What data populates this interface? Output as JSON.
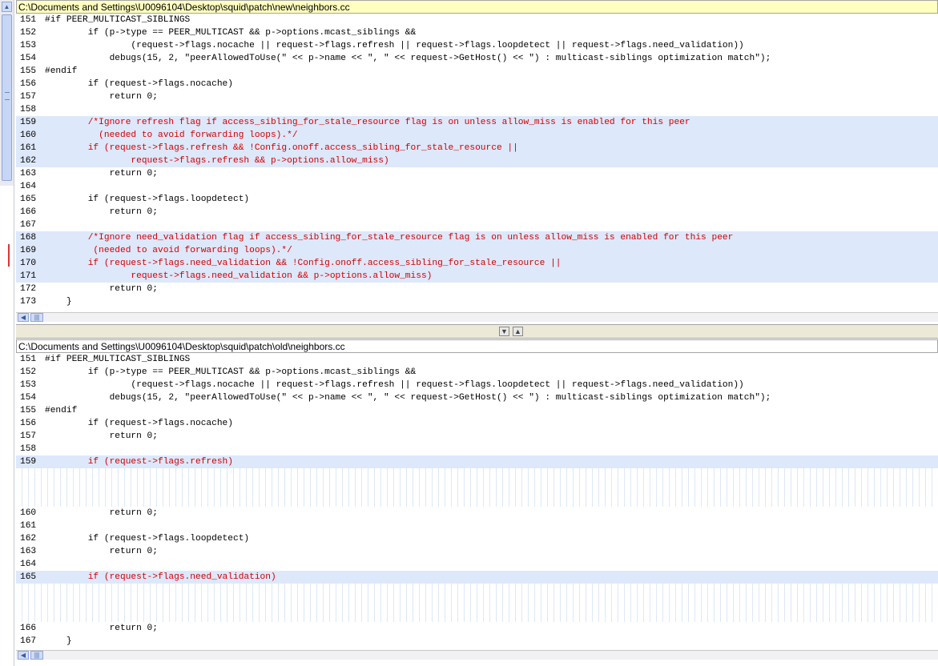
{
  "top_pane": {
    "title": "C:\\Documents and Settings\\U0096104\\Desktop\\squid\\patch\\new\\neighbors.cc",
    "lines": [
      {
        "n": "151",
        "code": "#if PEER_MULTICAST_SIBLINGS",
        "changed": false
      },
      {
        "n": "152",
        "code": "        if (p->type == PEER_MULTICAST && p->options.mcast_siblings &&",
        "changed": false
      },
      {
        "n": "153",
        "code": "                (request->flags.nocache || request->flags.refresh || request->flags.loopdetect || request->flags.need_validation))",
        "changed": false
      },
      {
        "n": "154",
        "code": "            debugs(15, 2, \"peerAllowedToUse(\" << p->name << \", \" << request->GetHost() << \") : multicast-siblings optimization match\");",
        "changed": false
      },
      {
        "n": "155",
        "code": "#endif",
        "changed": false
      },
      {
        "n": "156",
        "code": "        if (request->flags.nocache)",
        "changed": false
      },
      {
        "n": "157",
        "code": "            return 0;",
        "changed": false
      },
      {
        "n": "158",
        "code": "",
        "changed": false
      },
      {
        "n": "159",
        "code": "        /*Ignore refresh flag if access_sibling_for_stale_resource flag is on unless allow_miss is enabled for this peer",
        "changed": true
      },
      {
        "n": "160",
        "code": "          (needed to avoid forwarding loops).*/",
        "changed": true
      },
      {
        "n": "161",
        "code": "        if (request->flags.refresh && !Config.onoff.access_sibling_for_stale_resource ||",
        "changed": true
      },
      {
        "n": "162",
        "code": "                request->flags.refresh && p->options.allow_miss)",
        "changed": true
      },
      {
        "n": "163",
        "code": "            return 0;",
        "changed": false
      },
      {
        "n": "164",
        "code": "",
        "changed": false
      },
      {
        "n": "165",
        "code": "        if (request->flags.loopdetect)",
        "changed": false
      },
      {
        "n": "166",
        "code": "            return 0;",
        "changed": false
      },
      {
        "n": "167",
        "code": "",
        "changed": false
      },
      {
        "n": "168",
        "code": "        /*Ignore need_validation flag if access_sibling_for_stale_resource flag is on unless allow_miss is enabled for this peer",
        "changed": true
      },
      {
        "n": "169",
        "code": "         (needed to avoid forwarding loops).*/",
        "changed": true
      },
      {
        "n": "170",
        "code": "        if (request->flags.need_validation && !Config.onoff.access_sibling_for_stale_resource ||",
        "changed": true
      },
      {
        "n": "171",
        "code": "                request->flags.need_validation && p->options.allow_miss)",
        "changed": true
      },
      {
        "n": "172",
        "code": "            return 0;",
        "changed": false
      },
      {
        "n": "173",
        "code": "    }",
        "changed": false
      }
    ]
  },
  "bottom_pane": {
    "title": "C:\\Documents and Settings\\U0096104\\Desktop\\squid\\patch\\old\\neighbors.cc",
    "lines": [
      {
        "n": "151",
        "code": "#if PEER_MULTICAST_SIBLINGS",
        "kind": "normal"
      },
      {
        "n": "152",
        "code": "        if (p->type == PEER_MULTICAST && p->options.mcast_siblings &&",
        "kind": "normal"
      },
      {
        "n": "153",
        "code": "                (request->flags.nocache || request->flags.refresh || request->flags.loopdetect || request->flags.need_validation))",
        "kind": "normal"
      },
      {
        "n": "154",
        "code": "            debugs(15, 2, \"peerAllowedToUse(\" << p->name << \", \" << request->GetHost() << \") : multicast-siblings optimization match\");",
        "kind": "normal"
      },
      {
        "n": "155",
        "code": "#endif",
        "kind": "normal"
      },
      {
        "n": "156",
        "code": "        if (request->flags.nocache)",
        "kind": "normal"
      },
      {
        "n": "157",
        "code": "            return 0;",
        "kind": "normal"
      },
      {
        "n": "158",
        "code": "",
        "kind": "normal"
      },
      {
        "n": "159",
        "code": "        if (request->flags.refresh)",
        "kind": "changed"
      },
      {
        "n": "",
        "code": "",
        "kind": "blank"
      },
      {
        "n": "",
        "code": "",
        "kind": "blank"
      },
      {
        "n": "",
        "code": "",
        "kind": "blank"
      },
      {
        "n": "160",
        "code": "            return 0;",
        "kind": "normal"
      },
      {
        "n": "161",
        "code": "",
        "kind": "normal"
      },
      {
        "n": "162",
        "code": "        if (request->flags.loopdetect)",
        "kind": "normal"
      },
      {
        "n": "163",
        "code": "            return 0;",
        "kind": "normal"
      },
      {
        "n": "164",
        "code": "",
        "kind": "normal"
      },
      {
        "n": "165",
        "code": "        if (request->flags.need_validation)",
        "kind": "changed"
      },
      {
        "n": "",
        "code": "",
        "kind": "blank"
      },
      {
        "n": "",
        "code": "",
        "kind": "blank"
      },
      {
        "n": "",
        "code": "",
        "kind": "blank"
      },
      {
        "n": "166",
        "code": "            return 0;",
        "kind": "normal"
      },
      {
        "n": "167",
        "code": "    }",
        "kind": "normal"
      }
    ]
  },
  "icons": {
    "up": "scroll-up-icon",
    "left": "scroll-left-icon",
    "grip": "scroll-grip-icon",
    "next_diff": "next-diff-icon",
    "prev_diff": "prev-diff-icon"
  },
  "colors": {
    "changed_bg": "#dde8fa",
    "changed_text": "#d40000",
    "active_title_bg": "#ffffbf"
  }
}
